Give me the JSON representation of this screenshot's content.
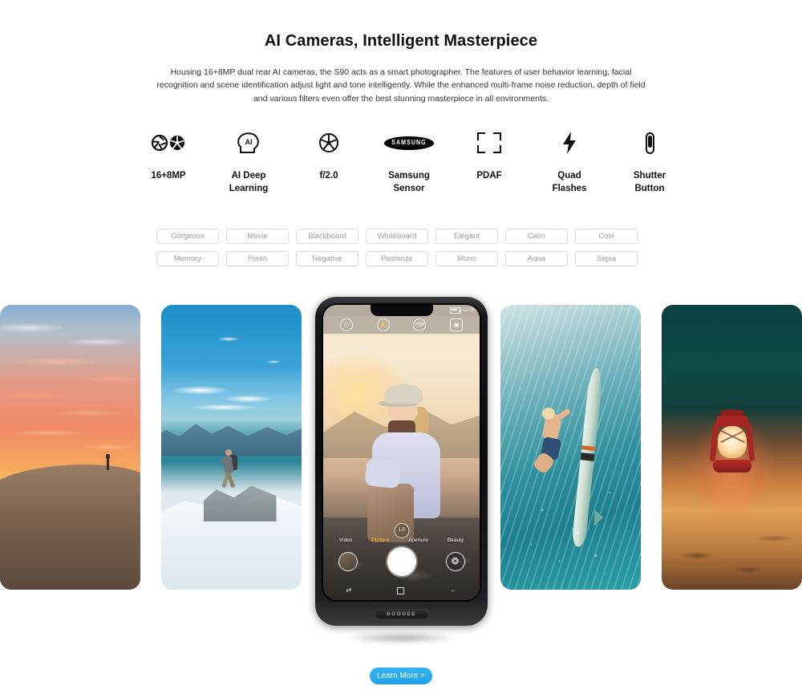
{
  "headline": "AI Cameras, Intelligent Masterpiece",
  "description": "Housing 16+8MP dual rear AI cameras, the S90 acts as a smart photographer. The features of user behavior learning, facial recognition and scene identification adjust light and tone intelligently. While the enhanced multi-frame noise reduction, depth of field and various filters even offer the best stunning masterpiece in all environments.",
  "features": [
    {
      "icon": "dual-aperture-icon",
      "label": "16+8MP"
    },
    {
      "icon": "ai-head-icon",
      "label": "AI Deep\nLearning"
    },
    {
      "icon": "aperture-icon",
      "label": "f/2.0"
    },
    {
      "icon": "samsung-logo-icon",
      "label": "Samsung\nSensor",
      "logo_text": "SAMSUNG"
    },
    {
      "icon": "focus-brackets-icon",
      "label": "PDAF"
    },
    {
      "icon": "lightning-bolt-icon",
      "label": "Quad\nFlashes"
    },
    {
      "icon": "shutter-button-icon",
      "label": "Shutter\nButton"
    }
  ],
  "filters": [
    "Gorgeous",
    "Movie",
    "Blackboard",
    "Whiteboard",
    "Elegant",
    "Calm",
    "Cool",
    "Memory",
    "Fresh",
    "Negative",
    "Posterize",
    "Mono",
    "Aqua",
    "Sepia"
  ],
  "gallery": [
    {
      "name": "desert-sunset-photo",
      "alt": "Silhouette of a person standing on a sand dune at sunset"
    },
    {
      "name": "snow-mountain-hiker-photo",
      "alt": "Hiker with backpack running across a snowy mountain ridge"
    },
    {
      "name": "underwater-surfer-photo",
      "alt": "Surfer duck-diving underwater holding a surfboard"
    },
    {
      "name": "red-lantern-photo",
      "alt": "Glowing red oil lantern resting on sand at night"
    }
  ],
  "phone": {
    "brand": "DOOGEE",
    "status": {
      "clock": "12:00",
      "battery": "battery-icon"
    },
    "top_icons": [
      "scene-mode-icon",
      "flash-icon",
      "hdr-icon",
      "switch-camera-icon"
    ],
    "modes": [
      {
        "label": "Video",
        "active": false
      },
      {
        "label": "Picture",
        "active": true
      },
      {
        "label": "Aperture",
        "active": false
      },
      {
        "label": "Beauty",
        "active": false
      }
    ],
    "zoom_badge": "1.0",
    "controls": {
      "gallery_thumb": "gallery-thumbnail",
      "shutter": "shutter-button",
      "effects": "effects-button"
    },
    "nav": [
      "recents-icon",
      "home-icon",
      "back-icon"
    ],
    "viewfinder_alt": "Smiling woman in a cap and light jacket with a backpack at golden hour"
  },
  "cta": {
    "label": "Learn More >"
  },
  "colors": {
    "accent_blue": "#1ea2ec",
    "mode_active": "#f5c042",
    "chip_border": "#d8dadc",
    "chip_text": "#9a9da1",
    "text": "#111111"
  }
}
